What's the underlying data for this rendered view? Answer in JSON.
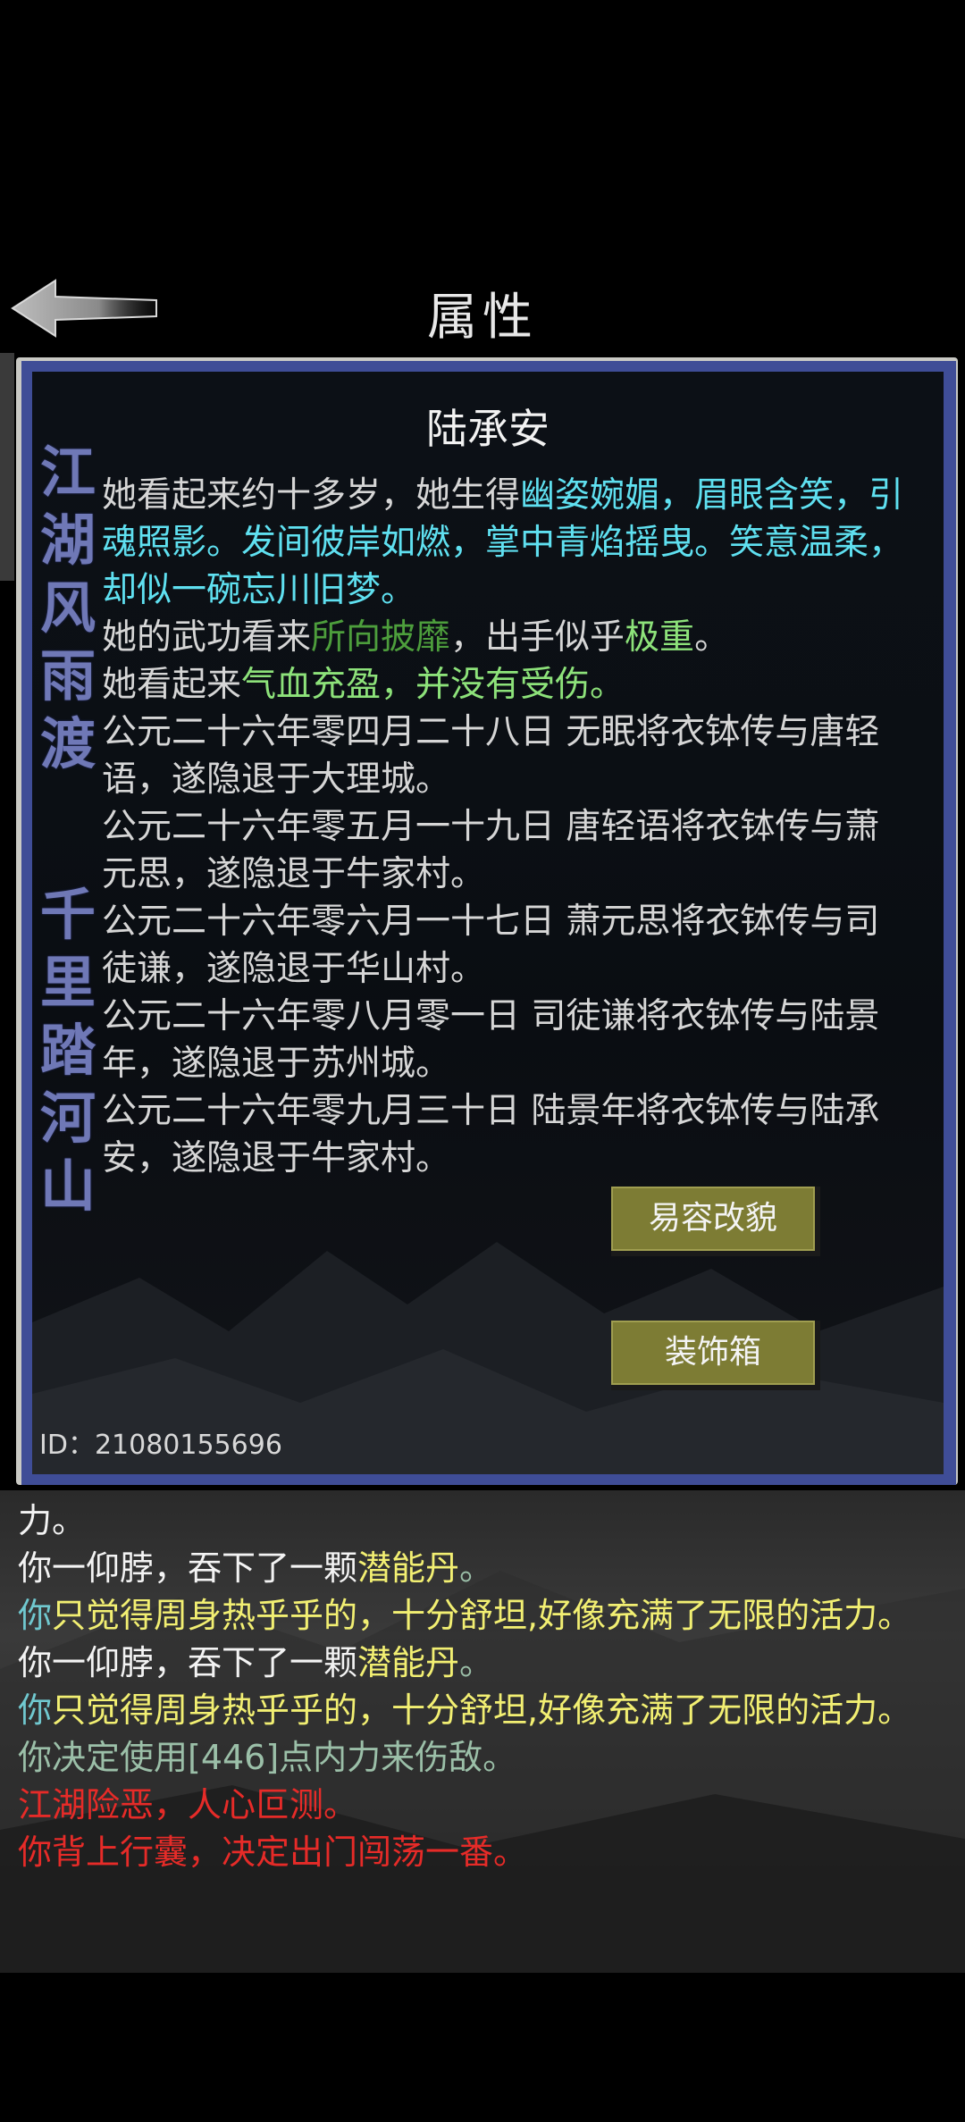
{
  "header": {
    "title": "属性"
  },
  "panel": {
    "character_name": "陆承安",
    "calligraphy_top": [
      "江",
      "湖",
      "风",
      "雨",
      "渡"
    ],
    "calligraphy_bottom": [
      "千",
      "里",
      "踏",
      "河",
      "山"
    ],
    "desc": {
      "l1_a": "她看起来约十多岁，她生得",
      "l1_b": "幽姿婉媚，眉眼含笑，引魂照影。发间彼岸如燃，掌中青焰摇曳。笑意温柔，却似一碗忘川旧梦",
      "l1_c": "。",
      "l2_a": "她的武功看来",
      "l2_b": "所向披靡",
      "l2_c": "，出手似乎",
      "l2_d": "极重",
      "l2_e": "。",
      "l3_a": "她看起来",
      "l3_b": "气血充盈，并没有受伤。",
      "h1": "公元二十六年零四月二十八日 无眠将衣钵传与唐轻语，遂隐退于大理城。",
      "h2": "公元二十六年零五月一十九日 唐轻语将衣钵传与萧元思，遂隐退于牛家村。",
      "h3": "公元二十六年零六月一十七日 萧元思将衣钵传与司徒谦，遂隐退于华山村。",
      "h4": "公元二十六年零八月零一日 司徒谦将衣钵传与陆景年，遂隐退于苏州城。",
      "h5": "公元二十六年零九月三十日 陆景年将衣钵传与陆承安，遂隐退于牛家村。"
    },
    "btn_disguise": "易容改貌",
    "btn_decor": "装饰箱",
    "player_id": "ID：21080155696"
  },
  "log": {
    "l1": "力。",
    "l2_a": "你一仰脖，吞下了一颗",
    "l2_b": "潜能丹",
    "l2_c": "。",
    "l3_a": "你",
    "l3_b": "只觉得周身热乎乎的，十分舒坦,好像充满了无限的活力。",
    "l4_a": "你一仰脖，吞下了一颗",
    "l4_b": "潜能丹",
    "l4_c": "。",
    "l5_a": "你",
    "l5_b": "只觉得周身热乎乎的，十分舒坦,好像充满了无限的活力。",
    "l6": "你决定使用[446]点内力来伤敌。",
    "l7": "江湖险恶，人心叵测。",
    "l8": "你背上行囊，决定出门闯荡一番。"
  },
  "colors": {
    "frame_blue": "#3f4d97",
    "button_olive": "#7d7c34",
    "cyan_text": "#5fe0f0",
    "green_text": "#8de27a",
    "yellow_text": "#f2ef72",
    "red_text": "#e62b28"
  },
  "icons": {
    "back": "back-arrow-icon"
  }
}
